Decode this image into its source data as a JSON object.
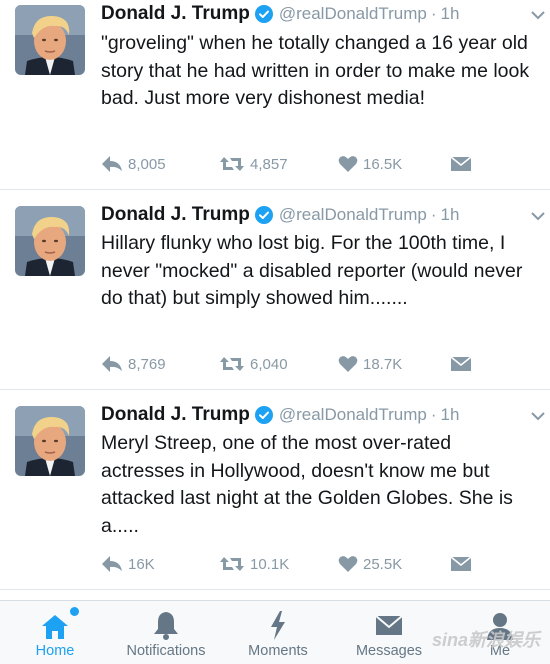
{
  "tweets": [
    {
      "name": "Donald J. Trump",
      "handle": "@realDonaldTrump",
      "separator": "·",
      "time": "1h",
      "text": "\"groveling\" when he totally changed a 16 year old story that he had written in order to make me look bad. Just more very dishonest media!",
      "replies": "8,005",
      "retweets": "4,857",
      "likes": "16.5K"
    },
    {
      "name": "Donald J. Trump",
      "handle": "@realDonaldTrump",
      "separator": "·",
      "time": "1h",
      "text": "Hillary flunky who lost big. For the 100th time, I never \"mocked\" a disabled reporter (would never do that) but simply showed him.......",
      "replies": "8,769",
      "retweets": "6,040",
      "likes": "18.7K"
    },
    {
      "name": "Donald J. Trump",
      "handle": "@realDonaldTrump",
      "separator": "·",
      "time": "1h",
      "text": "Meryl Streep, one of the most over-rated actresses in Hollywood, doesn't know me but attacked last night at the Golden Globes. She is a.....",
      "replies": "16K",
      "retweets": "10.1K",
      "likes": "25.5K"
    }
  ],
  "tabbar": {
    "home": "Home",
    "notifications": "Notifications",
    "moments": "Moments",
    "messages": "Messages",
    "me": "Me"
  },
  "watermark": "sina新浪娱乐",
  "colors": {
    "accent": "#1da1f2",
    "muted": "#8899a6",
    "text": "#14171a",
    "verified": "#1da1f2"
  },
  "icons": {
    "reply": "reply-icon",
    "retweet": "retweet-icon",
    "like": "heart-icon",
    "dm": "envelope-icon",
    "home": "home-icon",
    "notifications": "bell-icon",
    "moments": "lightning-icon",
    "messages": "envelope-icon",
    "me": "person-icon"
  }
}
